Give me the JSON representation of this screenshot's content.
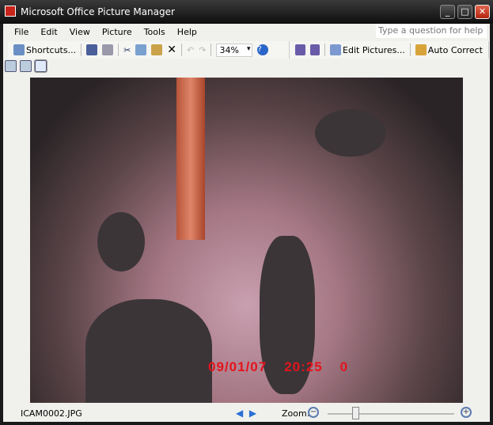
{
  "window": {
    "title": "Microsoft Office Picture Manager",
    "min": "_",
    "max": "□",
    "close": "✕"
  },
  "menu": [
    "File",
    "Edit",
    "View",
    "Picture",
    "Tools",
    "Help"
  ],
  "help_placeholder": "Type a question for help",
  "toolbar": {
    "shortcuts": "Shortcuts...",
    "zoom": "34%",
    "edit_pictures": "Edit Pictures...",
    "auto_correct": "Auto Correct"
  },
  "photo": {
    "stamp_date": "09/01/07",
    "stamp_time": "20:25",
    "stamp_num": "0"
  },
  "status": {
    "filename": "ICAM0002.JPG",
    "prev": "◀",
    "next": "▶",
    "zoom_label": "Zoom:",
    "zoom_out": "−",
    "zoom_in": "+",
    "zoom_slider_fraction": 0.22
  }
}
